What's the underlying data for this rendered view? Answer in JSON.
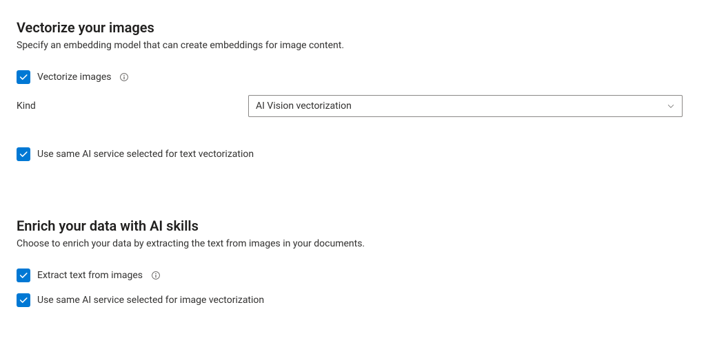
{
  "vectorize": {
    "title": "Vectorize your images",
    "desc": "Specify an embedding model that can create embeddings for image content.",
    "checkbox_label": "Vectorize images",
    "kind_label": "Kind",
    "kind_value": "AI Vision vectorization",
    "use_same_label": "Use same AI service selected for text vectorization"
  },
  "enrich": {
    "title": "Enrich your data with AI skills",
    "desc": "Choose to enrich your data by extracting the text from images in your documents.",
    "extract_label": "Extract text from images",
    "use_same_label": "Use same AI service selected for image vectorization"
  }
}
